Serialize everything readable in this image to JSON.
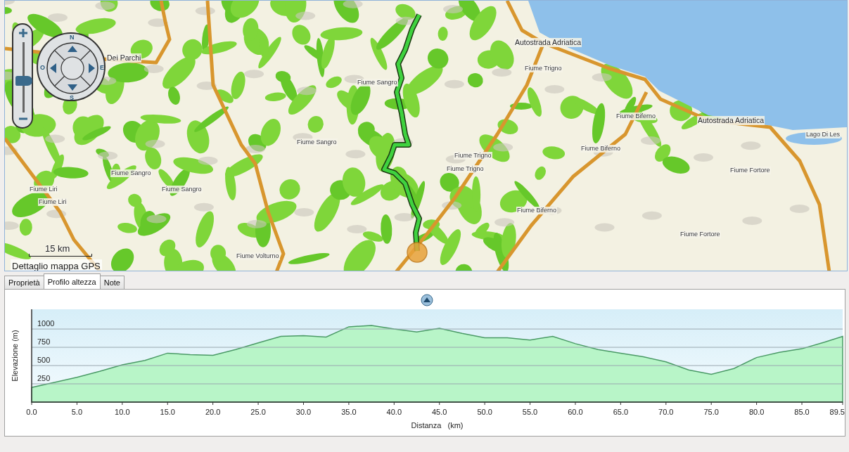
{
  "map": {
    "labels": [
      {
        "text": "Dei Parchi",
        "kind": "road"
      },
      {
        "text": "Autostrada Adriatica",
        "kind": "road"
      },
      {
        "text": "Fiume Trigno",
        "kind": "river"
      },
      {
        "text": "Fiume Sangro",
        "kind": "river"
      },
      {
        "text": "Fiume Biferno",
        "kind": "river"
      },
      {
        "text": "Autostrada Adriatica",
        "kind": "road"
      },
      {
        "text": "Lago Di Les",
        "kind": "lake"
      },
      {
        "text": "Fiume Sangro",
        "kind": "river"
      },
      {
        "text": "Fiume Biferno",
        "kind": "river"
      },
      {
        "text": "Fiume Trigno",
        "kind": "river"
      },
      {
        "text": "Fiume Trigno",
        "kind": "river"
      },
      {
        "text": "Fiume Sangro",
        "kind": "river"
      },
      {
        "text": "Fiume Fortore",
        "kind": "river"
      },
      {
        "text": "Fiume Liri",
        "kind": "river"
      },
      {
        "text": "Fiume Sangro",
        "kind": "river"
      },
      {
        "text": "Fiume Liri",
        "kind": "river"
      },
      {
        "text": "Fiume Biferno",
        "kind": "river"
      },
      {
        "text": "Fiume Fortore",
        "kind": "river"
      },
      {
        "text": "Fiume Volturno",
        "kind": "river"
      }
    ],
    "compass": {
      "north": "N",
      "west": "O",
      "east": "E",
      "south": "S"
    },
    "zoom": {
      "level": 0.45
    },
    "scale": "15 km",
    "caption": "Dettaglio mappa GPS"
  },
  "tabs": [
    {
      "label": "Proprietà",
      "selected": false
    },
    {
      "label": "Profilo altezza",
      "selected": true
    },
    {
      "label": "Note",
      "selected": false
    }
  ],
  "profile": {
    "chart_data": {
      "type": "area",
      "xlabel": "Distanza   (km)",
      "ylabel": "Elevazione (m)",
      "x": [
        0,
        2.5,
        5,
        7.5,
        10,
        12.5,
        15,
        17.5,
        20,
        22.5,
        25,
        27.5,
        30,
        32.5,
        35,
        37.5,
        40,
        42.5,
        45,
        47.5,
        50,
        52.5,
        55,
        57.5,
        60,
        62.5,
        65,
        67.5,
        70,
        72.5,
        75,
        77.5,
        80,
        82.5,
        85,
        87.5,
        89.5
      ],
      "series": [
        {
          "color": "#b8f5c8",
          "values": [
            200,
            270,
            340,
            420,
            510,
            570,
            670,
            650,
            640,
            720,
            810,
            900,
            910,
            890,
            1030,
            1050,
            1000,
            960,
            1010,
            940,
            880,
            880,
            850,
            900,
            800,
            720,
            670,
            620,
            550,
            440,
            380,
            460,
            610,
            680,
            730,
            820,
            900
          ]
        }
      ],
      "grid": true,
      "xlim": [
        0,
        89.5
      ],
      "ylim": [
        0,
        1270
      ],
      "xticks": [
        {
          "value": 0,
          "label": "0.0"
        },
        {
          "value": 5,
          "label": "5.0"
        },
        {
          "value": 10,
          "label": "10.0"
        },
        {
          "value": 15,
          "label": "15.0"
        },
        {
          "value": 20,
          "label": "20.0"
        },
        {
          "value": 25,
          "label": "25.0"
        },
        {
          "value": 30,
          "label": "30.0"
        },
        {
          "value": 35,
          "label": "35.0"
        },
        {
          "value": 40,
          "label": "40.0"
        },
        {
          "value": 45,
          "label": "45.0"
        },
        {
          "value": 50,
          "label": "50.0"
        },
        {
          "value": 55,
          "label": "55.0"
        },
        {
          "value": 60,
          "label": "60.0"
        },
        {
          "value": 65,
          "label": "65.0"
        },
        {
          "value": 70,
          "label": "70.0"
        },
        {
          "value": 75,
          "label": "75.0"
        },
        {
          "value": 80,
          "label": "80.0"
        },
        {
          "value": 85,
          "label": "85.0"
        },
        {
          "value": 89.5,
          "label": "89.5"
        }
      ],
      "yticks": [
        250,
        500,
        750,
        1000
      ]
    }
  }
}
